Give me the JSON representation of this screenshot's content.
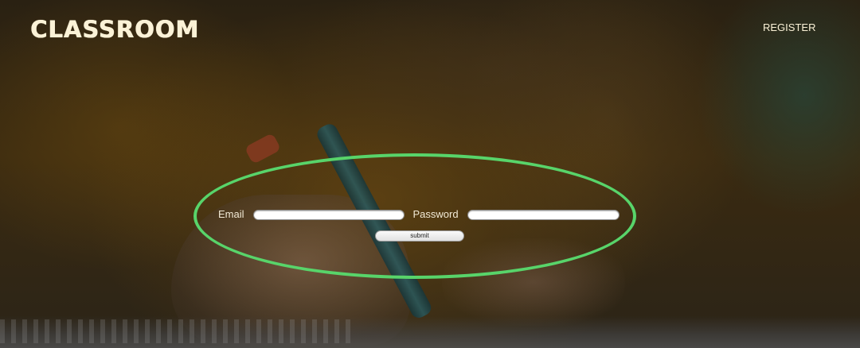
{
  "header": {
    "logo_text": "CLASSROOM",
    "register_label": "REGISTER"
  },
  "login_form": {
    "email_label": "Email",
    "email_value": "",
    "password_label": "Password",
    "password_value": "",
    "submit_label": "submit"
  },
  "colors": {
    "logo": "#fbf2d7",
    "highlight_ring": "#58d46a",
    "label_text": "#f2ead6"
  }
}
